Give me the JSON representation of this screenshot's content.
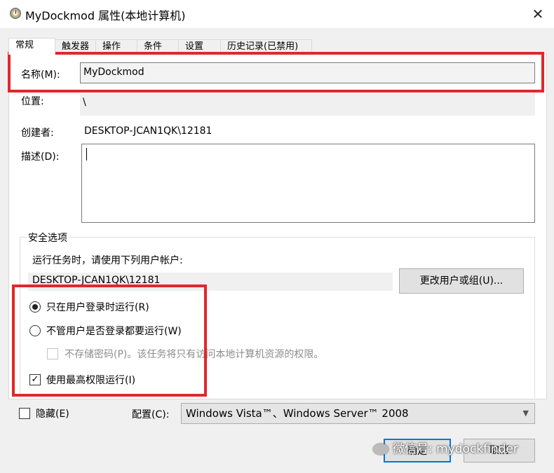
{
  "window": {
    "title": "MyDockmod 属性(本地计算机)",
    "close": "✕"
  },
  "tabs": [
    {
      "label": "常规"
    },
    {
      "label": "触发器"
    },
    {
      "label": "操作"
    },
    {
      "label": "条件"
    },
    {
      "label": "设置"
    },
    {
      "label": "历史记录(已禁用)"
    }
  ],
  "general": {
    "name_label": "名称(M):",
    "name_value": "MyDockmod",
    "location_label": "位置:",
    "location_value": "\\",
    "author_label": "创建者:",
    "author_value": "DESKTOP-JCAN1QK\\12181",
    "description_label": "描述(D):",
    "description_value": ""
  },
  "security": {
    "group_label": "安全选项",
    "run_as_prompt": "运行任务时，请使用下列用户帐户:",
    "account_value": "DESKTOP-JCAN1QK\\12181",
    "change_button": "更改用户或组(U)...",
    "radio_logged_on": "只在用户登录时运行(R)",
    "radio_logged_on_selected": true,
    "radio_any": "不管用户是否登录都要运行(W)",
    "do_not_store_password": "不存储密码(P)。该任务将只有访问本地计算机资源的权限。",
    "highest_privileges": "使用最高权限运行(I)",
    "highest_privileges_checked": true
  },
  "footer": {
    "hidden_label": "隐藏(E)",
    "configure_label": "配置(C):",
    "configure_value": "Windows Vista™、Windows Server™ 2008",
    "ok_button": "确定",
    "cancel_button": "取消"
  },
  "watermark": "微信号: mydockfinder",
  "colors": {
    "highlight": "#e0282b",
    "default_button_border": "#0078d7"
  }
}
